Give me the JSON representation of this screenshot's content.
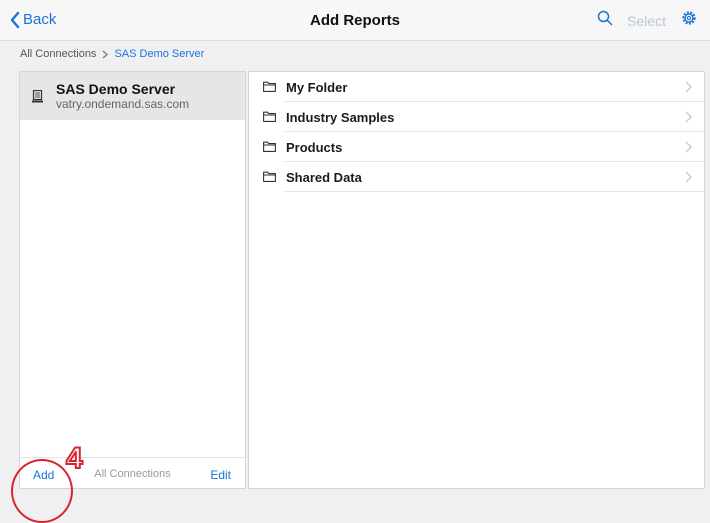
{
  "navbar": {
    "back_label": "Back",
    "title": "Add Reports",
    "select_label": "Select",
    "icons": [
      "chevron-left-icon",
      "search-icon",
      "gear-icon"
    ]
  },
  "breadcrumb": {
    "root": "All Connections",
    "separator": ">",
    "current": "SAS Demo Server"
  },
  "connections": {
    "items": [
      {
        "name": "SAS Demo Server",
        "host": "vatry.ondemand.sas.com",
        "icon": "server-icon"
      }
    ],
    "footer": {
      "add_label": "Add",
      "center_label": "All Connections",
      "edit_label": "Edit"
    }
  },
  "folders": [
    {
      "label": "My Folder"
    },
    {
      "label": "Industry Samples"
    },
    {
      "label": "Products"
    },
    {
      "label": "Shared Data"
    }
  ],
  "annotation": {
    "step_number": "4"
  },
  "colors": {
    "accent": "#1a73d9",
    "annotation": "#d9232e",
    "disabled": "#b9c7d8",
    "selected_row": "#e6e6e9"
  }
}
